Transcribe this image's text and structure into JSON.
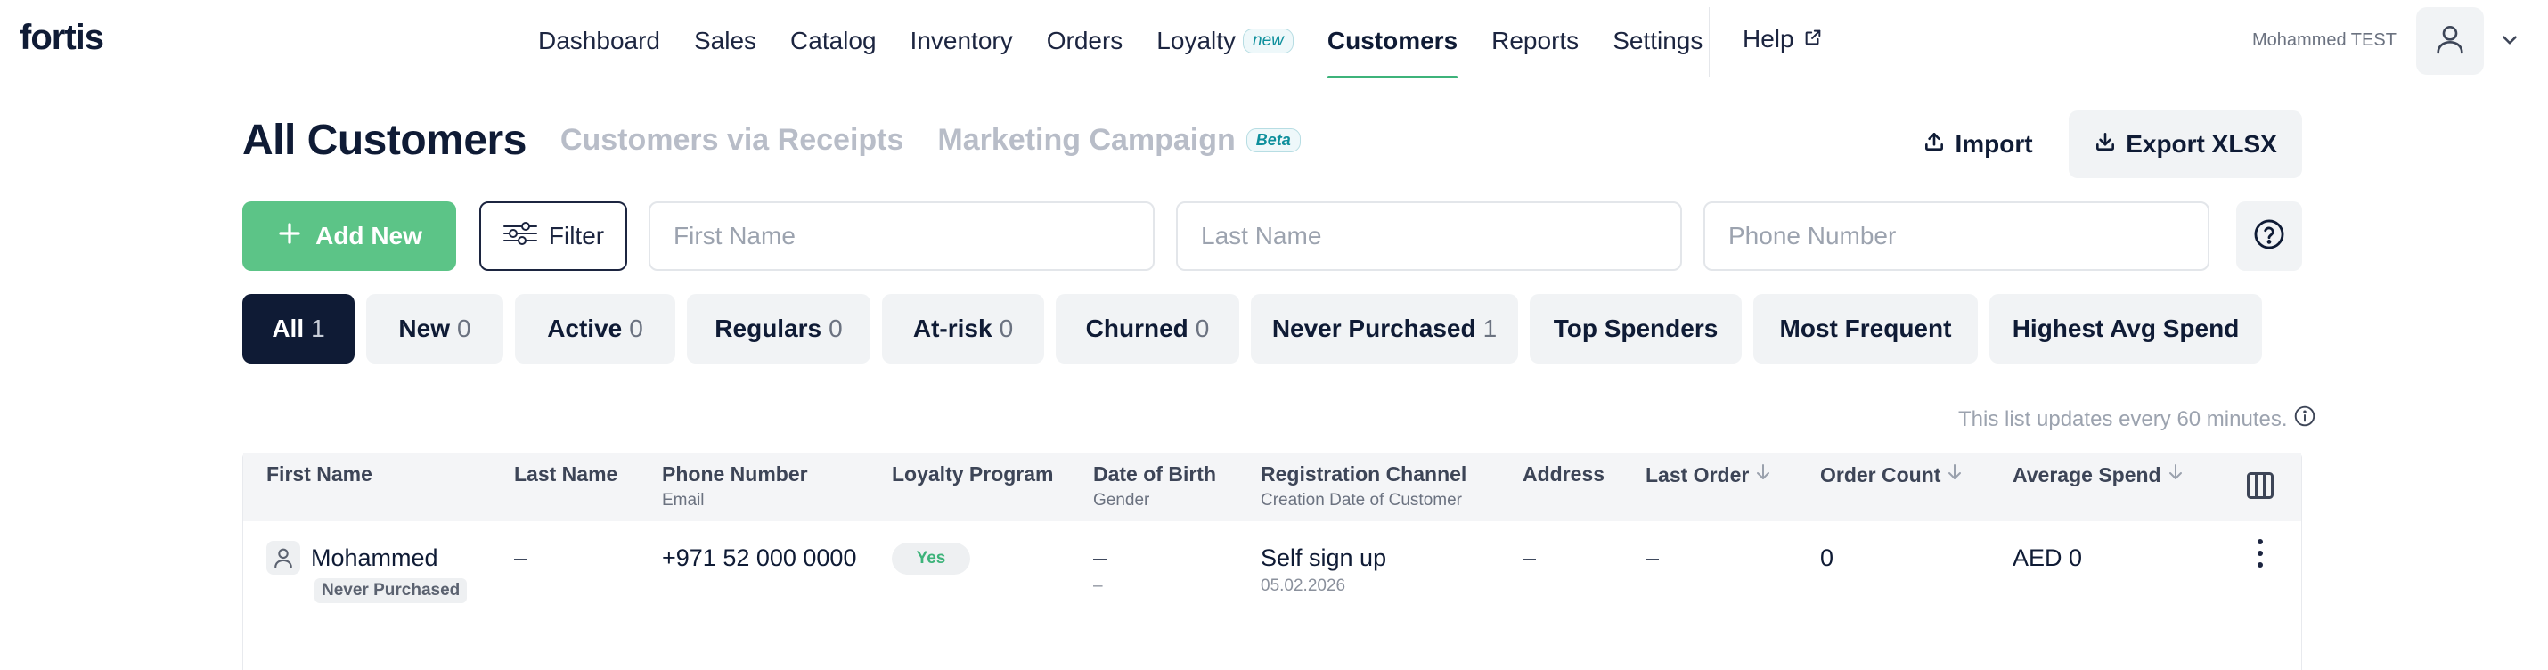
{
  "app": {
    "logo": "fortis"
  },
  "nav": {
    "items": [
      {
        "label": "Dashboard"
      },
      {
        "label": "Sales"
      },
      {
        "label": "Catalog"
      },
      {
        "label": "Inventory"
      },
      {
        "label": "Orders"
      },
      {
        "label": "Loyalty",
        "badge": "new"
      },
      {
        "label": "Customers",
        "active": true
      },
      {
        "label": "Reports"
      },
      {
        "label": "Settings"
      }
    ],
    "help": "Help",
    "user_name": "Mohammed TEST"
  },
  "page": {
    "title": "All Customers",
    "tab_receipts": "Customers via Receipts",
    "tab_marketing": "Marketing Campaign",
    "beta_badge": "Beta",
    "import_label": "Import",
    "export_label": "Export XLSX"
  },
  "controls": {
    "add_new": "Add New",
    "filter": "Filter",
    "first_name_placeholder": "First Name",
    "last_name_placeholder": "Last Name",
    "phone_placeholder": "Phone Number"
  },
  "segments": [
    {
      "label": "All",
      "count": "1",
      "active": true
    },
    {
      "label": "New",
      "count": "0"
    },
    {
      "label": "Active",
      "count": "0"
    },
    {
      "label": "Regulars",
      "count": "0"
    },
    {
      "label": "At-risk",
      "count": "0"
    },
    {
      "label": "Churned",
      "count": "0"
    },
    {
      "label": "Never Purchased",
      "count": "1"
    },
    {
      "label": "Top Spenders",
      "count": ""
    },
    {
      "label": "Most Frequent",
      "count": ""
    },
    {
      "label": "Highest Avg Spend",
      "count": ""
    }
  ],
  "update_note": "This list updates every 60 minutes.",
  "table": {
    "headers": {
      "first_name": "First Name",
      "last_name": "Last Name",
      "phone": "Phone Number",
      "email": "Email",
      "loyalty": "Loyalty Program",
      "dob": "Date of Birth",
      "gender": "Gender",
      "reg_channel": "Registration Channel",
      "creation_date": "Creation Date of Customer",
      "address": "Address",
      "last_order": "Last Order",
      "order_count": "Order Count",
      "avg_spend": "Average Spend"
    },
    "rows": [
      {
        "first_name": "Mohammed",
        "tag": "Never Purchased",
        "last_name": "–",
        "phone": "+971 52 000 0000",
        "loyalty": "Yes",
        "dob": "–",
        "gender": "–",
        "reg_channel": "Self sign up",
        "creation_date": "05.02.2026",
        "address": "–",
        "last_order": "–",
        "order_count": "0",
        "avg_spend": "AED 0"
      }
    ]
  }
}
